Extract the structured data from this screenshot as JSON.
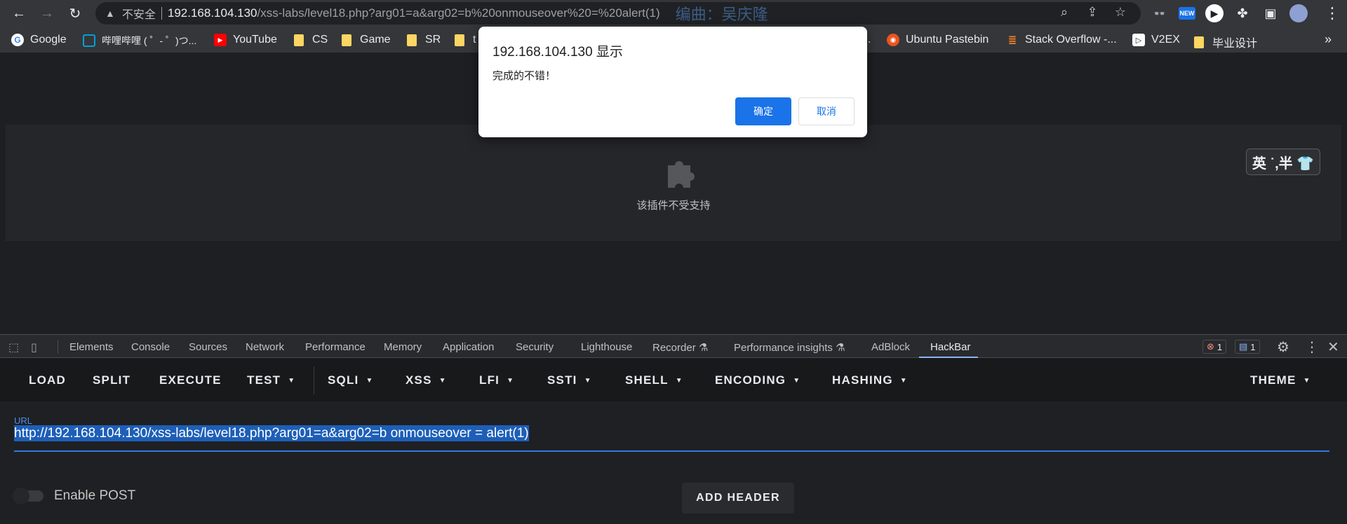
{
  "browser": {
    "insecure_label": "不安全",
    "url_host": "192.168.104.130",
    "url_path": "/xss-labs/level18.php?arg01=a&arg02=b%20onmouseover%20=%20alert(1)",
    "overlay_text": "编曲：吴庆隆"
  },
  "bookmarks": [
    {
      "label": "Google",
      "icon": "google-icon"
    },
    {
      "label": "哔哩哔哩 ( ゜- ゜)つ...",
      "icon": "bilibili-icon"
    },
    {
      "label": "YouTube",
      "icon": "youtube-icon"
    },
    {
      "label": "CS",
      "icon": "folder-icon"
    },
    {
      "label": "Game",
      "icon": "folder-icon"
    },
    {
      "label": "SR",
      "icon": "folder-icon"
    },
    {
      "label": "t",
      "icon": "folder-icon"
    },
    {
      "label": "...",
      "icon": ""
    },
    {
      "label": "Ubuntu Pastebin",
      "icon": "ubuntu-icon"
    },
    {
      "label": "Stack Overflow -...",
      "icon": "stackoverflow-icon"
    },
    {
      "label": "V2EX",
      "icon": "v2ex-icon"
    },
    {
      "label": "毕业设计",
      "icon": "folder-icon"
    }
  ],
  "page": {
    "plugin_message": "该插件不受支持",
    "ime_indicator": "英 ˙,半 👕"
  },
  "dialog": {
    "title": "192.168.104.130 显示",
    "message": "完成的不错！",
    "ok_label": "确定",
    "cancel_label": "取消"
  },
  "devtools": {
    "tabs": [
      "Elements",
      "Console",
      "Sources",
      "Network",
      "Performance",
      "Memory",
      "Application",
      "Security",
      "Lighthouse",
      "Recorder ⚗",
      "Performance insights ⚗",
      "AdBlock",
      "HackBar"
    ],
    "active_tab": "HackBar",
    "error_count": "1",
    "message_count": "1"
  },
  "hackbar": {
    "menu": [
      {
        "label": "LOAD",
        "dropdown": false
      },
      {
        "label": "SPLIT",
        "dropdown": false
      },
      {
        "label": "EXECUTE",
        "dropdown": false
      },
      {
        "label": "TEST",
        "dropdown": true
      },
      {
        "label": "SQLI",
        "dropdown": true
      },
      {
        "label": "XSS",
        "dropdown": true
      },
      {
        "label": "LFI",
        "dropdown": true
      },
      {
        "label": "SSTI",
        "dropdown": true
      },
      {
        "label": "SHELL",
        "dropdown": true
      },
      {
        "label": "ENCODING",
        "dropdown": true
      },
      {
        "label": "HASHING",
        "dropdown": true
      },
      {
        "label": "THEME",
        "dropdown": true
      }
    ],
    "url_label": "URL",
    "url_value": "http://192.168.104.130/xss-labs/level18.php?arg01=a&arg02=b onmouseover = alert(1)",
    "enable_post_label": "Enable POST",
    "add_header_label": "ADD HEADER"
  },
  "colors": {
    "accent": "#1a73e8",
    "hackbar_highlight": "#1d5fb8",
    "devtools_active_underline": "#8ab4f8"
  }
}
